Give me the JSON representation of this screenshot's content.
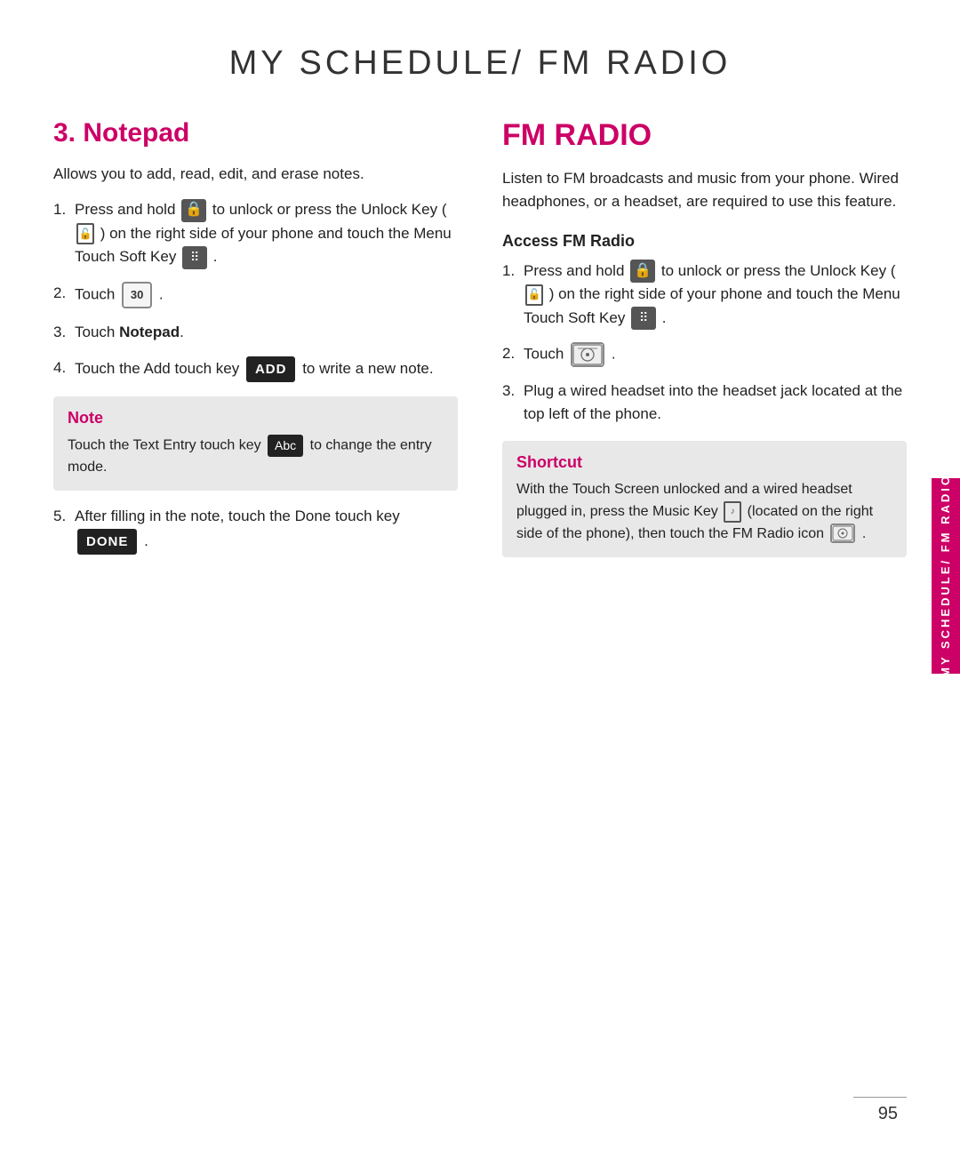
{
  "page": {
    "title": "MY SCHEDULE/ FM RADIO",
    "page_number": "95",
    "sidebar_label": "MY SCHEDULE/ FM RADIO"
  },
  "notepad": {
    "heading": "3. Notepad",
    "intro": "Allows you to add, read, edit, and erase notes.",
    "steps": [
      {
        "num": "1.",
        "text_before": "Press and hold",
        "icon1": "lock",
        "text_middle": "to unlock or press the Unlock Key (",
        "icon2": "unlock-small",
        "text_after": ") on the right side of your phone and touch the Menu Touch Soft Key",
        "icon3": "grid"
      },
      {
        "num": "2.",
        "text_before": "Touch",
        "icon": "calendar-30"
      },
      {
        "num": "3.",
        "text": "Touch Notepad.",
        "bold_word": "Notepad"
      },
      {
        "num": "4.",
        "text_before": "Touch the Add touch key",
        "btn": "ADD",
        "text_after": "to write a new note."
      },
      {
        "num": "5.",
        "text_before": "After filling in the note, touch the Done touch key",
        "btn": "DONE"
      }
    ],
    "note": {
      "heading": "Note",
      "text_before": "Touch the Text Entry touch key",
      "btn": "Abc",
      "text_after": "to change the entry mode."
    }
  },
  "fm_radio": {
    "heading": "FM RADIO",
    "intro": "Listen to FM broadcasts and music from your phone. Wired headphones, or a headset, are required to use this feature.",
    "access_heading": "Access FM Radio",
    "steps": [
      {
        "num": "1.",
        "text_before": "Press and hold",
        "icon1": "lock",
        "text_middle": "to unlock or press the Unlock Key (",
        "icon2": "unlock-small",
        "text_after": ") on the right side of your phone and touch the Menu Touch Soft Key",
        "icon3": "grid"
      },
      {
        "num": "2.",
        "text_before": "Touch",
        "icon": "fm-icon"
      },
      {
        "num": "3.",
        "text": "Plug a wired headset into the headset jack located at the top left of the phone."
      }
    ],
    "shortcut": {
      "heading": "Shortcut",
      "text": "With the Touch Screen unlocked and a wired headset plugged in, press the Music Key",
      "text2": "(located on the right side of the phone), then touch the FM Radio icon",
      "icon_end": "fm-small"
    }
  }
}
